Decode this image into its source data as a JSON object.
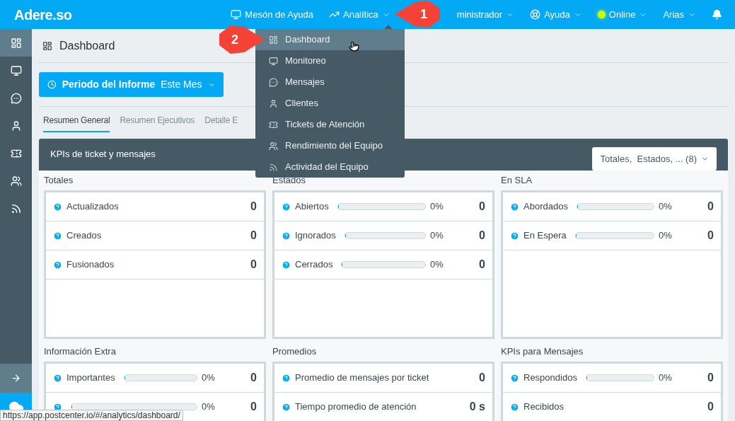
{
  "brand": "Adere.so",
  "nav": [
    {
      "label": "Mesón de Ayuda",
      "caret": false
    },
    {
      "label": "Analítica",
      "caret": true
    },
    {
      "label": "ministrador",
      "caret": true
    },
    {
      "label": "Ayuda",
      "caret": true
    },
    {
      "label": "Online",
      "caret": true,
      "color": "#c6ff00"
    },
    {
      "label": "Arias",
      "caret": true
    }
  ],
  "sidebar": {
    "items": [
      {
        "selected": true
      },
      {
        "selected": false
      },
      {
        "selected": false
      },
      {
        "selected": false
      },
      {
        "selected": false
      },
      {
        "selected": false
      },
      {
        "selected": false
      }
    ]
  },
  "page_title": "Dashboard",
  "period": {
    "label": "Periodo del Informe",
    "value": "Este Mes"
  },
  "tabs": [
    {
      "label": "Resumen General",
      "selected": true
    },
    {
      "label": "Resumen Ejecutivos",
      "selected": false
    },
    {
      "label": "Detalle E",
      "selected": false
    }
  ],
  "panel": {
    "title": "KPIs de ticket y mensajes",
    "filter": "Totales,  Estados, ... (8)"
  },
  "sections": [
    {
      "title": "Totales",
      "rows": [
        {
          "kind": "plain",
          "label": "Actualizados",
          "value": "0"
        },
        {
          "kind": "plain",
          "label": "Creados",
          "value": "0"
        },
        {
          "kind": "plain",
          "label": "Fusionados",
          "value": "0"
        }
      ]
    },
    {
      "title": "Estados",
      "rows": [
        {
          "kind": "bar",
          "label": "Abiertos",
          "level": 0,
          "percent": "0%",
          "value": "0"
        },
        {
          "kind": "bar",
          "label": "Ignorados",
          "level": 0,
          "percent": "0%",
          "value": "0"
        },
        {
          "kind": "bar",
          "label": "Cerrados",
          "level": 0,
          "percent": "0%",
          "value": "0"
        }
      ]
    },
    {
      "title": "En SLA",
      "rows": [
        {
          "kind": "bar",
          "label": "Abordados",
          "level": 0,
          "percent": "0%",
          "value": "0"
        },
        {
          "kind": "bar",
          "label": "En Espera",
          "level": 0,
          "percent": "0%",
          "value": "0"
        }
      ]
    },
    {
      "title": "Información Extra",
      "rows": [
        {
          "kind": "bar",
          "label": "Importantes",
          "level": 0,
          "percent": "0%",
          "value": "0"
        },
        {
          "kind": "bar",
          "level": 0,
          "percent": "0%",
          "value": "0"
        }
      ]
    },
    {
      "title": "Promedios",
      "rows": [
        {
          "kind": "plain",
          "label": "Promedio de mensajes por ticket",
          "value": "0"
        },
        {
          "kind": "plain",
          "label": "Tiempo promedio de atención",
          "value": "0 s"
        }
      ]
    },
    {
      "title": "KPIs para Mensajes",
      "rows": [
        {
          "kind": "bar",
          "label": "Respondidos",
          "level": 0,
          "percent": "0%",
          "value": "0"
        },
        {
          "kind": "plain",
          "label": "Recibidos",
          "value": "0"
        }
      ]
    }
  ],
  "menu": [
    {
      "label": "Dashboard",
      "selected": true
    },
    {
      "label": "Monitoreo",
      "selected": false
    },
    {
      "label": "Mensajes",
      "selected": false
    },
    {
      "label": "Clientes",
      "selected": false
    },
    {
      "label": "Tickets de Atención",
      "selected": false
    },
    {
      "label": "Rendimiento del Equipo",
      "selected": false
    },
    {
      "label": "Actividad del Equipo",
      "selected": false
    }
  ],
  "callouts": [
    "1",
    "2"
  ],
  "status_url": "https://app.postcenter.io/#/analytics/dashboard/"
}
